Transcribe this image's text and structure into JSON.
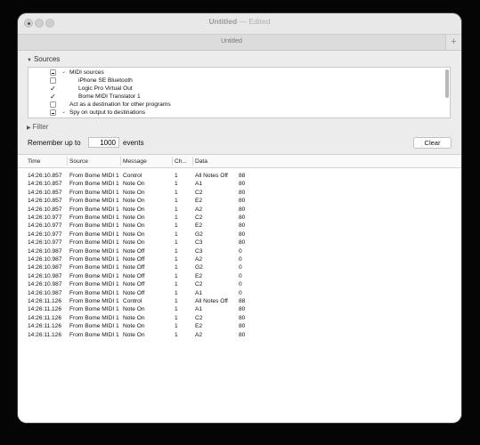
{
  "window": {
    "title": "Untitled",
    "title_suffix": "— Edited",
    "tab_label": "Untitled",
    "tab_add_label": "+"
  },
  "sources": {
    "heading": "Sources",
    "items": [
      {
        "label": "MIDI sources",
        "check": "mixed",
        "disclosure": true,
        "indent": 0
      },
      {
        "label": "iPhone SE Bluetooth",
        "check": "off",
        "indent": 1
      },
      {
        "label": "Logic Pro Virtual Out",
        "check": "on",
        "indent": 1
      },
      {
        "label": "Bome MIDI Translator 1",
        "check": "on",
        "indent": 1
      },
      {
        "label": "Act as a destination for other programs",
        "check": "off",
        "indent": 0
      },
      {
        "label": "Spy on output to destinations",
        "check": "mixed",
        "disclosure": true,
        "indent": 0
      }
    ]
  },
  "filter": {
    "heading": "Filter"
  },
  "remember": {
    "label": "Remember up to",
    "value": "1000",
    "suffix": "events",
    "clear_label": "Clear"
  },
  "table": {
    "columns": [
      "Time",
      "Source",
      "Message",
      "Ch...",
      "Data"
    ],
    "rows": [
      [
        "14:26:10.857",
        "From Bome MIDI 1",
        "Control",
        "1",
        "All Notes Off",
        "88"
      ],
      [
        "14:26:10.857",
        "From Bome MIDI 1",
        "Note On",
        "1",
        "A1",
        "80"
      ],
      [
        "14:26:10.857",
        "From Bome MIDI 1",
        "Note On",
        "1",
        "C2",
        "80"
      ],
      [
        "14:26:10.857",
        "From Bome MIDI 1",
        "Note On",
        "1",
        "E2",
        "80"
      ],
      [
        "14:26:10.857",
        "From Bome MIDI 1",
        "Note On",
        "1",
        "A2",
        "80"
      ],
      [
        "14:26:10.977",
        "From Bome MIDI 1",
        "Note On",
        "1",
        "C2",
        "80"
      ],
      [
        "14:26:10.977",
        "From Bome MIDI 1",
        "Note On",
        "1",
        "E2",
        "80"
      ],
      [
        "14:26:10.977",
        "From Bome MIDI 1",
        "Note On",
        "1",
        "G2",
        "80"
      ],
      [
        "14:26:10.977",
        "From Bome MIDI 1",
        "Note On",
        "1",
        "C3",
        "80"
      ],
      [
        "14:26:10.987",
        "From Bome MIDI 1",
        "Note Off",
        "1",
        "C3",
        "0"
      ],
      [
        "14:26:10.987",
        "From Bome MIDI 1",
        "Note Off",
        "1",
        "A2",
        "0"
      ],
      [
        "14:26:10.987",
        "From Bome MIDI 1",
        "Note Off",
        "1",
        "G2",
        "0"
      ],
      [
        "14:26:10.987",
        "From Bome MIDI 1",
        "Note Off",
        "1",
        "E2",
        "0"
      ],
      [
        "14:26:10.987",
        "From Bome MIDI 1",
        "Note Off",
        "1",
        "C2",
        "0"
      ],
      [
        "14:26:10.987",
        "From Bome MIDI 1",
        "Note Off",
        "1",
        "A1",
        "0"
      ],
      [
        "14:26:11.126",
        "From Bome MIDI 1",
        "Control",
        "1",
        "All Notes Off",
        "88"
      ],
      [
        "14:26:11.126",
        "From Bome MIDI 1",
        "Note On",
        "1",
        "A1",
        "80"
      ],
      [
        "14:26:11.126",
        "From Bome MIDI 1",
        "Note On",
        "1",
        "C2",
        "80"
      ],
      [
        "14:26:11.126",
        "From Bome MIDI 1",
        "Note On",
        "1",
        "E2",
        "80"
      ],
      [
        "14:26:11.126",
        "From Bome MIDI 1",
        "Note On",
        "1",
        "A2",
        "80"
      ]
    ]
  }
}
